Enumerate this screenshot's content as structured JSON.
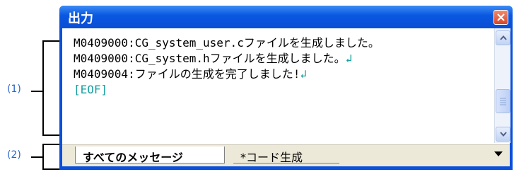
{
  "callouts": {
    "output_area": "(1)",
    "tab_area": "(2)"
  },
  "window": {
    "title": "出力",
    "close_icon": "close-icon"
  },
  "messages": [
    {
      "text": "M0409000:CG_system_user.cファイルを生成しました。",
      "eol": ""
    },
    {
      "text": "M0409000:CG_system.hファイルを生成しました。",
      "eol": "↲"
    },
    {
      "text": "M0409004:ファイルの生成を完了しました!",
      "eol": "↲"
    }
  ],
  "eof_marker": "[EOF]",
  "tabs": [
    {
      "label": "すべてのメッセージ",
      "active": true
    },
    {
      "label": "*コード生成",
      "active": false
    }
  ],
  "colors": {
    "titlebar": "#0a58e0",
    "callout": "#2a66c9",
    "eol_marker": "#16a0a0"
  }
}
